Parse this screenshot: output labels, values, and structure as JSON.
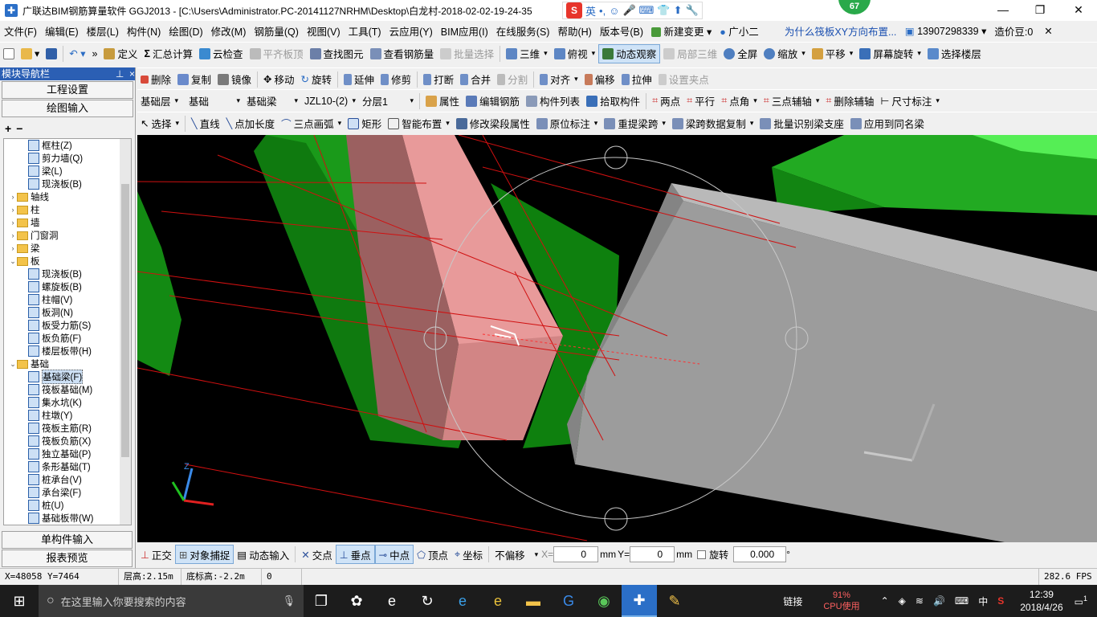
{
  "window": {
    "title": "广联达BIM钢筋算量软件 GGJ2013 - [C:\\Users\\Administrator.PC-20141127NRHM\\Desktop\\白龙村-2018-02-02-19-24-35"
  },
  "ime": {
    "lang": "英",
    "badge": "67"
  },
  "menu": [
    "文件(F)",
    "编辑(E)",
    "楼层(L)",
    "构件(N)",
    "绘图(D)",
    "修改(M)",
    "钢筋量(Q)",
    "视图(V)",
    "工具(T)",
    "云应用(Y)",
    "BIM应用(I)",
    "在线服务(S)",
    "帮助(H)",
    "版本号(B)"
  ],
  "menu_extra": {
    "new_change": "新建变更",
    "assistant": "广小二",
    "question": "为什么筏板XY方向布置...",
    "phone": "13907298339",
    "coins": "造价豆:0"
  },
  "toolbar1": [
    "定义",
    "汇总计算",
    "云检查",
    "平齐板顶",
    "查找图元",
    "查看钢筋量",
    "批量选择",
    "三维",
    "俯视",
    "动态观察",
    "局部三维",
    "全屏",
    "缩放",
    "平移",
    "屏幕旋转",
    "选择楼层"
  ],
  "toolbar2": [
    "删除",
    "复制",
    "镜像",
    "移动",
    "旋转",
    "延伸",
    "修剪",
    "打断",
    "合并",
    "分割",
    "对齐",
    "偏移",
    "拉伸",
    "设置夹点"
  ],
  "toolbar3": {
    "floor": "基础层",
    "category": "基础",
    "type": "基础梁",
    "element": "JZL10-(2)",
    "layer": "分层1",
    "buttons": [
      "属性",
      "编辑钢筋",
      "构件列表",
      "拾取构件",
      "两点",
      "平行",
      "点角",
      "三点辅轴",
      "删除辅轴",
      "尺寸标注"
    ]
  },
  "toolbar4": [
    "选择",
    "直线",
    "点加长度",
    "三点画弧",
    "矩形",
    "智能布置",
    "修改梁段属性",
    "原位标注",
    "重提梁跨",
    "梁跨数据复制",
    "批量识别梁支座",
    "应用到同名梁"
  ],
  "panel": {
    "title": "模块导航栏",
    "pin": "ᅟ",
    "close": "×",
    "btn_project": "工程设置",
    "btn_draw": "绘图输入",
    "btn_single": "单构件输入",
    "btn_report": "报表预览"
  },
  "tree": [
    {
      "indent": 2,
      "label": "框柱(Z)",
      "type": "item"
    },
    {
      "indent": 2,
      "label": "剪力墙(Q)",
      "type": "item"
    },
    {
      "indent": 2,
      "label": "梁(L)",
      "type": "item"
    },
    {
      "indent": 2,
      "label": "现浇板(B)",
      "type": "item"
    },
    {
      "indent": 0,
      "label": "轴线",
      "type": "folder",
      "exp": "›"
    },
    {
      "indent": 0,
      "label": "柱",
      "type": "folder",
      "exp": "›"
    },
    {
      "indent": 0,
      "label": "墙",
      "type": "folder",
      "exp": "›"
    },
    {
      "indent": 0,
      "label": "门窗洞",
      "type": "folder",
      "exp": "›"
    },
    {
      "indent": 0,
      "label": "梁",
      "type": "folder",
      "exp": "›"
    },
    {
      "indent": 0,
      "label": "板",
      "type": "folder",
      "exp": "⌄"
    },
    {
      "indent": 2,
      "label": "现浇板(B)",
      "type": "item"
    },
    {
      "indent": 2,
      "label": "螺旋板(B)",
      "type": "item"
    },
    {
      "indent": 2,
      "label": "柱帽(V)",
      "type": "item"
    },
    {
      "indent": 2,
      "label": "板洞(N)",
      "type": "item"
    },
    {
      "indent": 2,
      "label": "板受力筋(S)",
      "type": "item"
    },
    {
      "indent": 2,
      "label": "板负筋(F)",
      "type": "item"
    },
    {
      "indent": 2,
      "label": "楼层板带(H)",
      "type": "item"
    },
    {
      "indent": 0,
      "label": "基础",
      "type": "folder",
      "exp": "⌄"
    },
    {
      "indent": 2,
      "label": "基础梁(F)",
      "type": "item",
      "selected": true
    },
    {
      "indent": 2,
      "label": "筏板基础(M)",
      "type": "item"
    },
    {
      "indent": 2,
      "label": "集水坑(K)",
      "type": "item"
    },
    {
      "indent": 2,
      "label": "柱墩(Y)",
      "type": "item"
    },
    {
      "indent": 2,
      "label": "筏板主筋(R)",
      "type": "item"
    },
    {
      "indent": 2,
      "label": "筏板负筋(X)",
      "type": "item"
    },
    {
      "indent": 2,
      "label": "独立基础(P)",
      "type": "item"
    },
    {
      "indent": 2,
      "label": "条形基础(T)",
      "type": "item"
    },
    {
      "indent": 2,
      "label": "桩承台(V)",
      "type": "item"
    },
    {
      "indent": 2,
      "label": "承台梁(F)",
      "type": "item"
    },
    {
      "indent": 2,
      "label": "桩(U)",
      "type": "item"
    },
    {
      "indent": 2,
      "label": "基础板带(W)",
      "type": "item"
    }
  ],
  "bottom": {
    "ortho": "正交",
    "snap": "对象捕捉",
    "dyn": "动态输入",
    "intersect": "交点",
    "perp": "垂点",
    "mid": "中点",
    "vertex": "顶点",
    "coord": "坐标",
    "offset": "不偏移",
    "x_label": "X=",
    "x": "0",
    "y_label": "Y=",
    "y": "0",
    "unit": "mm",
    "rotate": "旋转",
    "angle": "0.000",
    "deg": "°"
  },
  "status": {
    "coords": "X=48058 Y=7464",
    "floor_h": "层高:2.15m",
    "base_h": "底标高:-2.2m",
    "zero": "0",
    "fps": "282.6 FPS"
  },
  "taskbar": {
    "search": "在这里输入你要搜索的内容",
    "link": "链接",
    "cpu_pct": "91%",
    "cpu": "CPU使用",
    "ime": "中",
    "time": "12:39",
    "date": "2018/4/26",
    "notif": "1"
  },
  "axes": {
    "z": "Z"
  }
}
